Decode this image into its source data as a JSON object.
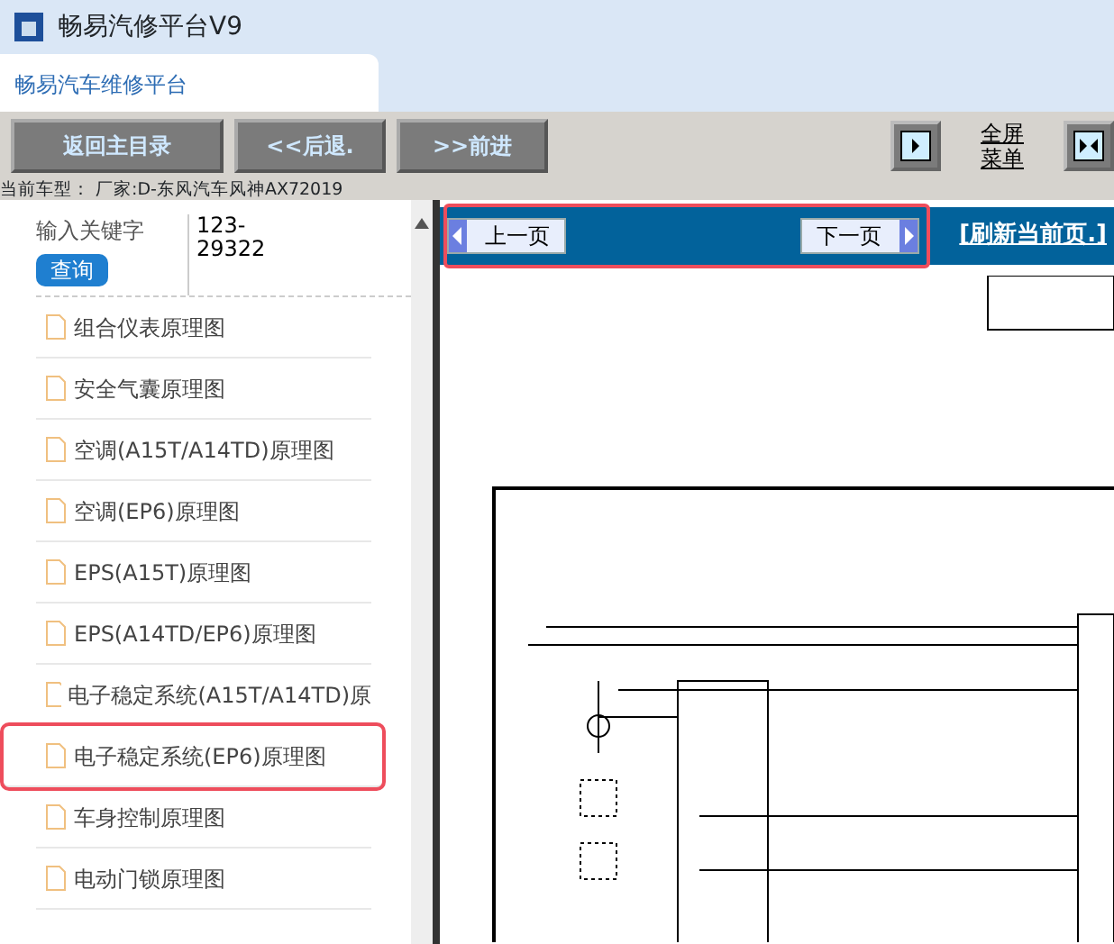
{
  "window": {
    "title": "畅易汽修平台V9"
  },
  "tabs": [
    {
      "label": "畅易汽车维修平台",
      "selected": true
    }
  ],
  "toolbar": {
    "buttons": [
      "返回主目录",
      "<<后退.",
      ">>前进"
    ],
    "fullscreen_link": [
      "全屏",
      "菜单"
    ]
  },
  "vehicle_line": "当前车型： 厂家:D-东风汽车风神AX72019",
  "search": {
    "label": "输入关键字",
    "value": "123-29322",
    "button": "查询"
  },
  "documents": [
    {
      "title": "组合仪表原理图",
      "selected": false
    },
    {
      "title": "安全气囊原理图",
      "selected": false
    },
    {
      "title": "空调(A15T/A14TD)原理图",
      "selected": false
    },
    {
      "title": "空调(EP6)原理图",
      "selected": false
    },
    {
      "title": "EPS(A15T)原理图",
      "selected": false
    },
    {
      "title": "EPS(A14TD/EP6)原理图",
      "selected": false
    },
    {
      "title": "电子稳定系统(A15T/A14TD)原",
      "selected": false
    },
    {
      "title": "电子稳定系统(EP6)原理图",
      "selected": true
    },
    {
      "title": "车身控制原理图",
      "selected": false
    },
    {
      "title": "电动门锁原理图",
      "selected": false
    }
  ],
  "viewer": {
    "prev_button": "上一页",
    "next_button": "下一页",
    "refresh_link": "[刷新当前页.]"
  }
}
